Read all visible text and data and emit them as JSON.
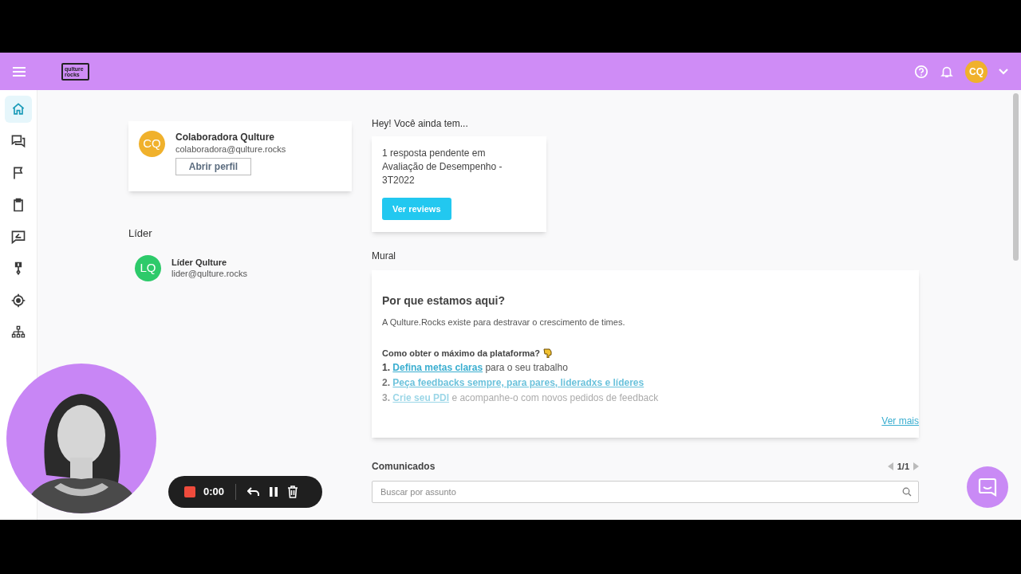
{
  "header": {
    "logo": [
      "qulture",
      "rocks"
    ],
    "avatar_initials": "CQ"
  },
  "sidebar": {
    "items": [
      {
        "kind": "home",
        "selected": true
      },
      {
        "kind": "chat",
        "selected": false
      },
      {
        "kind": "flag",
        "selected": false
      },
      {
        "kind": "clipboard",
        "selected": false
      },
      {
        "kind": "feedback",
        "selected": false
      },
      {
        "kind": "medal",
        "selected": false
      },
      {
        "kind": "target",
        "selected": false
      },
      {
        "kind": "org",
        "selected": false
      }
    ]
  },
  "profile": {
    "initials": "CQ",
    "color": "#f0b12c",
    "name": "Colaboradora Qulture",
    "email": "colaboradora@qulture.rocks",
    "button": "Abrir perfil"
  },
  "leader": {
    "title": "Líder",
    "initials": "LQ",
    "color": "#2dca6a",
    "name": "Líder Qulture",
    "email": "lider@qulture.rocks"
  },
  "pending": {
    "heading": "Hey! Você ainda tem...",
    "text": "1 resposta pendente em Avaliação de Desempenho - 3T2022",
    "button": "Ver reviews"
  },
  "mural": {
    "heading": "Mural",
    "title": "Por que estamos aqui?",
    "intro": "A Qulture.Rocks existe para destravar o crescimento de times.",
    "subheading": "Como obter o máximo da plataforma?",
    "items": [
      {
        "number": "1.",
        "link": "Defina metas claras",
        "rest": " para o seu trabalho"
      },
      {
        "number": "2.",
        "link": "Peça feedbacks sempre, para pares, lideradxs e líderes"
      },
      {
        "number": "3.",
        "link": "Crie seu PDI",
        "rest": " e acompanhe-o com novos pedidos de feedback"
      }
    ],
    "more": "Ver mais"
  },
  "announcements": {
    "heading": "Comunicados",
    "pager": "1/1",
    "search": {
      "placeholder": "Buscar por assunto"
    }
  },
  "recorder": {
    "time": "0:00"
  }
}
